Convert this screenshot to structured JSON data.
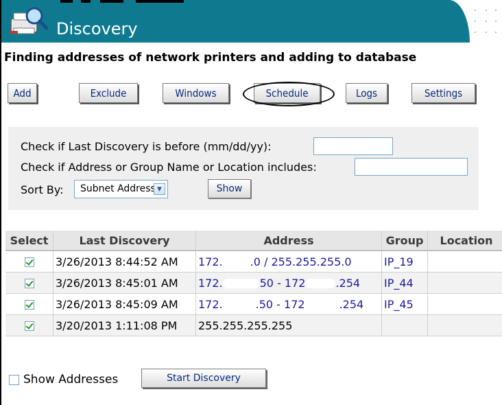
{
  "header": {
    "title": "Discovery",
    "subtitle": "Finding addresses of network printers and adding to database"
  },
  "toolbar": {
    "buttons": [
      {
        "label": "Add"
      },
      {
        "label": "Exclude"
      },
      {
        "label": "Windows"
      },
      {
        "label": "Schedule",
        "highlighted": true
      },
      {
        "label": "Logs"
      },
      {
        "label": "Settings"
      }
    ]
  },
  "filters": {
    "last_discovery_label": "Check if Last Discovery is before (mm/dd/yy):",
    "last_discovery_value": "",
    "address_label": "Check if Address or Group Name or Location includes:",
    "address_value": "",
    "sort_label": "Sort By:",
    "sort_value": "Subnet Address",
    "show_label": "Show"
  },
  "table": {
    "headers": [
      "Select",
      "Last Discovery",
      "Address",
      "Group",
      "Location"
    ],
    "rows": [
      {
        "checked": true,
        "last_discovery": "3/26/2013 8:44:52 AM",
        "address_a": "172.",
        "address_b": ".0 / 255.255.255.0",
        "address_c": "",
        "group": "IP_19",
        "location": ""
      },
      {
        "checked": true,
        "last_discovery": "3/26/2013 8:45:01 AM",
        "address_a": "172.",
        "address_b": "50 - 172",
        "address_c": ".254",
        "group": "IP_44",
        "location": ""
      },
      {
        "checked": true,
        "last_discovery": "3/26/2013 8:45:09 AM",
        "address_a": "172.",
        "address_b": ".50 - 172",
        "address_c": ".254",
        "group": "IP_45",
        "location": ""
      },
      {
        "checked": true,
        "last_discovery": "3/20/2013 1:11:08 PM",
        "address_a": "255.255.255.255",
        "address_b": "",
        "address_c": "",
        "group": "",
        "location": ""
      }
    ]
  },
  "footer": {
    "show_addresses_label": "Show Addresses",
    "show_addresses_checked": false,
    "start_label": "Start Discovery"
  },
  "colors": {
    "header_bg": "#0f7a8f",
    "link_blue": "#1a1aa0",
    "check_green": "#1f9a2a"
  }
}
